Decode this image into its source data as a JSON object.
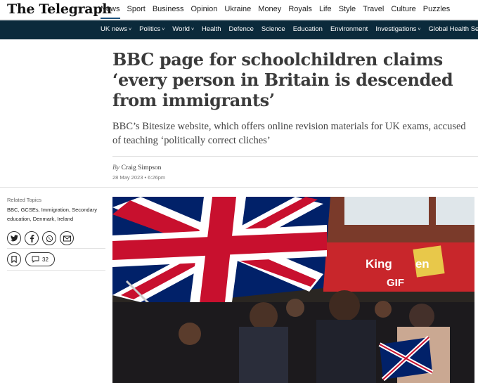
{
  "brand": {
    "logo_text": "The Telegraph"
  },
  "main_nav": [
    "News",
    "Sport",
    "Business",
    "Opinion",
    "Ukraine",
    "Money",
    "Royals",
    "Life",
    "Style",
    "Travel",
    "Culture",
    "Puzzles"
  ],
  "sub_nav": [
    {
      "label": "UK news",
      "dropdown": true
    },
    {
      "label": "Politics",
      "dropdown": true
    },
    {
      "label": "World",
      "dropdown": true
    },
    {
      "label": "Health",
      "dropdown": false
    },
    {
      "label": "Defence",
      "dropdown": false
    },
    {
      "label": "Science",
      "dropdown": false
    },
    {
      "label": "Education",
      "dropdown": false
    },
    {
      "label": "Environment",
      "dropdown": false
    },
    {
      "label": "Investigations",
      "dropdown": true
    },
    {
      "label": "Global Health Security",
      "dropdown": false
    }
  ],
  "article": {
    "headline": "BBC page for schoolchildren claims ‘every person in Britain is descended from immigrants’",
    "standfirst": "BBC’s Bitesize website, which offers online revision materials for UK exams, accused of teaching ‘politically correct cliches’",
    "byline_prefix": "By",
    "author": "Craig Simpson",
    "date": "28 May 2023 • 6:26pm"
  },
  "sidebar": {
    "related_label": "Related Topics",
    "related_topics": "BBC, GCSEs, Immigration, Secondary education, Denmark, Ireland",
    "share_icons": [
      "twitter-icon",
      "facebook-icon",
      "whatsapp-icon",
      "email-icon"
    ],
    "comment_count": "32"
  },
  "hero": {
    "sign_line1": "King",
    "sign_line2": "GIF",
    "sign_partial": "en",
    "colors": {
      "flag_blue": "#012169",
      "flag_red": "#C8102E",
      "sign_red": "#c8262b"
    }
  },
  "colors": {
    "subnav_bg": "#0b2a3b",
    "nav_active": "#1a4f7a"
  }
}
